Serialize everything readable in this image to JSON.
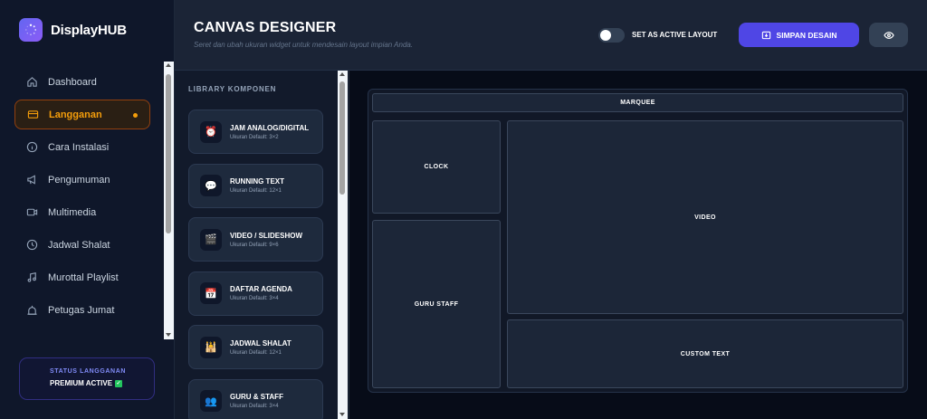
{
  "brand": {
    "name": "DisplayHUB",
    "icon": "spinner-logo-icon"
  },
  "nav": [
    {
      "label": "Dashboard",
      "icon": "home-icon",
      "active": false
    },
    {
      "label": "Langganan",
      "icon": "card-icon",
      "active": true
    },
    {
      "label": "Cara Instalasi",
      "icon": "info-icon",
      "active": false
    },
    {
      "label": "Pengumuman",
      "icon": "megaphone-icon",
      "active": false
    },
    {
      "label": "Multimedia",
      "icon": "video-camera-icon",
      "active": false
    },
    {
      "label": "Jadwal Shalat",
      "icon": "clock-icon",
      "active": false
    },
    {
      "label": "Murottal Playlist",
      "icon": "music-note-icon",
      "active": false
    },
    {
      "label": "Petugas Jumat",
      "icon": "mosque-icon",
      "active": false
    }
  ],
  "status": {
    "label": "STATUS LANGGANAN",
    "value": "PREMIUM ACTIVE",
    "badge": "✓"
  },
  "header": {
    "title": "CANVAS DESIGNER",
    "subtitle": "Seret dan ubah ukuran widget untuk mendesain layout impian Anda.",
    "toggle_label": "SET AS ACTIVE LAYOUT",
    "toggle_on": false,
    "save_label": "SIMPAN DESAIN"
  },
  "library": {
    "title": "LIBRARY KOMPONEN",
    "items": [
      {
        "name": "JAM ANALOG/DIGITAL",
        "size": "Ukuran Default: 3×2",
        "icon": "alarm-clock-icon",
        "glyph": "⏰"
      },
      {
        "name": "RUNNING TEXT",
        "size": "Ukuran Default: 12×1",
        "icon": "speech-bubble-icon",
        "glyph": "💬"
      },
      {
        "name": "VIDEO / SLIDESHOW",
        "size": "Ukuran Default: 9×6",
        "icon": "clapper-icon",
        "glyph": "🎬"
      },
      {
        "name": "DAFTAR AGENDA",
        "size": "Ukuran Default: 3×4",
        "icon": "calendar-icon",
        "glyph": "📅"
      },
      {
        "name": "JADWAL SHALAT",
        "size": "Ukuran Default: 12×1",
        "icon": "mosque-icon",
        "glyph": "🕌"
      },
      {
        "name": "GURU & STAFF",
        "size": "Ukuran Default: 3×4",
        "icon": "people-icon",
        "glyph": "👥"
      }
    ]
  },
  "canvas": {
    "widgets": {
      "marquee": "MARQUEE",
      "clock": "CLOCK",
      "video": "VIDEO",
      "guru_staff": "GURU STAFF",
      "custom_text": "CUSTOM TEXT"
    }
  },
  "colors": {
    "accent": "#4f46e5",
    "active_nav": "#f59e0b",
    "premium": "#818cf8"
  }
}
